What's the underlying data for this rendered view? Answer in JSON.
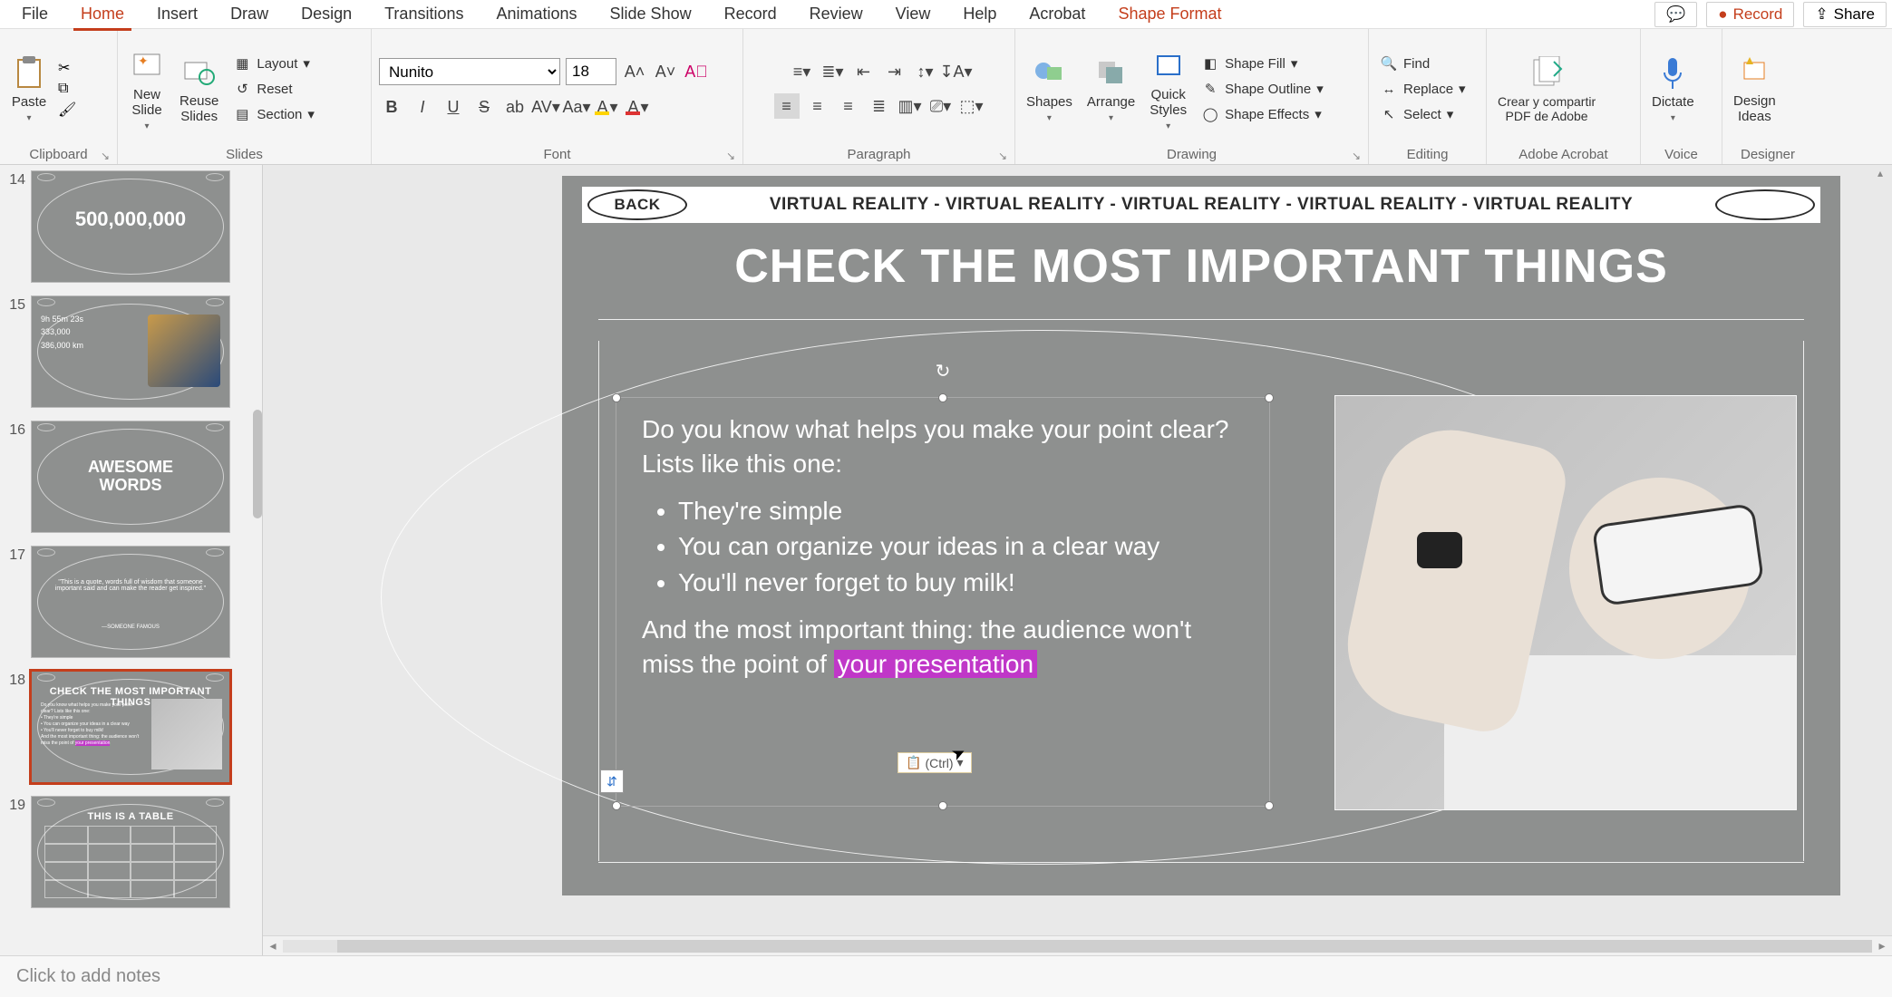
{
  "menubar": {
    "tabs": [
      "File",
      "Home",
      "Insert",
      "Draw",
      "Design",
      "Transitions",
      "Animations",
      "Slide Show",
      "Record",
      "Review",
      "View",
      "Help",
      "Acrobat",
      "Shape Format"
    ],
    "active": "Home",
    "highlighted": "Shape Format",
    "record": "Record",
    "share": "Share"
  },
  "ribbon": {
    "clipboard": {
      "paste": "Paste",
      "label": "Clipboard"
    },
    "slides": {
      "new": "New\nSlide",
      "reuse": "Reuse\nSlides",
      "layout": "Layout",
      "reset": "Reset",
      "section": "Section",
      "label": "Slides"
    },
    "font": {
      "name": "Nunito",
      "size": "18",
      "label": "Font"
    },
    "paragraph": {
      "label": "Paragraph"
    },
    "drawing": {
      "shapes": "Shapes",
      "arrange": "Arrange",
      "quick": "Quick\nStyles",
      "fill": "Shape Fill",
      "outline": "Shape Outline",
      "effects": "Shape Effects",
      "label": "Drawing"
    },
    "editing": {
      "find": "Find",
      "replace": "Replace",
      "select": "Select",
      "label": "Editing"
    },
    "acrobat": {
      "btn": "Crear y compartir\nPDF de Adobe",
      "label": "Adobe Acrobat"
    },
    "voice": {
      "btn": "Dictate",
      "label": "Voice"
    },
    "designer": {
      "btn": "Design\nIdeas",
      "label": "Designer"
    }
  },
  "thumbs": [
    {
      "n": "14",
      "big": "500,000,000"
    },
    {
      "n": "15",
      "lines": [
        "9h 55m 23s",
        "333,000",
        "386,000 km"
      ]
    },
    {
      "n": "16",
      "center": "AWESOME\nWORDS"
    },
    {
      "n": "17",
      "quote": "\"This is a quote, words full of wisdom that someone important said and can make the reader get inspired.\"",
      "by": "—SOMEONE FAMOUS"
    },
    {
      "n": "18",
      "title": "CHECK THE MOST IMPORTANT THINGS"
    },
    {
      "n": "19",
      "title": "THIS IS A TABLE"
    }
  ],
  "slide": {
    "back": "BACK",
    "ticker": "VIRTUAL REALITY  - VIRTUAL REALITY - VIRTUAL REALITY  - VIRTUAL REALITY - VIRTUAL REALITY",
    "title": "CHECK THE MOST IMPORTANT THINGS",
    "intro": "Do you know what helps you make your point clear? Lists like this one:",
    "bullets": [
      "They're simple",
      "You can organize your ideas in a clear way",
      "You'll never forget to buy milk!"
    ],
    "outro_before": "And the most important thing: the audience won't miss the point of ",
    "outro_hl": "your presentation",
    "paste_badge": "(Ctrl)"
  },
  "notes": {
    "placeholder": "Click to add notes"
  }
}
